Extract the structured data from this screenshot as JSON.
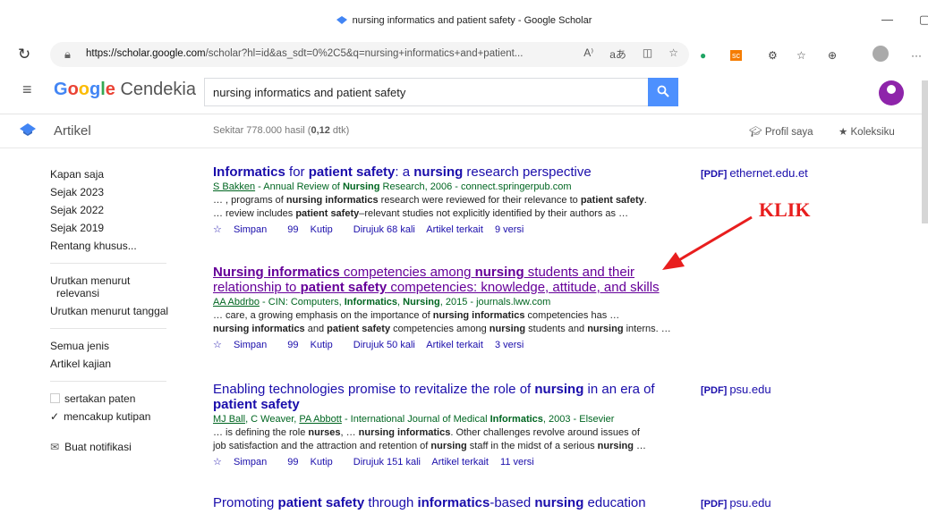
{
  "browser": {
    "tab_title": "nursing informatics and patient safety - Google Scholar",
    "url_host": "https://scholar.google.com",
    "url_path": "/scholar?hl=id&as_sdt=0%2C5&q=nursing+informatics+and+patient...",
    "refresh_icon": "refresh-icon",
    "ext_sc": "sc"
  },
  "header": {
    "logo_google": "Google",
    "logo_rest": " Cendekia",
    "query": "nursing informatics and patient safety"
  },
  "subheader": {
    "section": "Artikel",
    "stats_prefix": "Sekitar 778.000 hasil (",
    "stats_time": "0,12",
    "stats_suffix": " dtk)",
    "profile": "Profil saya",
    "collection": "Koleksiku"
  },
  "sidebar": {
    "time_any": "Kapan saja",
    "time_items": [
      "Sejak 2023",
      "Sejak 2022",
      "Sejak 2019",
      "Rentang khusus..."
    ],
    "sort_rel_1": "Urutkan menurut",
    "sort_rel_2": "relevansi",
    "sort_date": "Urutkan menurut tanggal",
    "type_all": "Semua jenis",
    "type_review": "Artikel kajian",
    "incl_patents": "sertakan paten",
    "incl_citations": "mencakup kutipan",
    "alert": "Buat notifikasi"
  },
  "annotation": {
    "klik": "KLIK"
  },
  "results": [
    {
      "pdf_tag": "[PDF]",
      "pdf_host": "ethernet.edu.et",
      "cited": "Dirujuk 68 kali",
      "versions": "9 versi"
    },
    {
      "cited": "Dirujuk 50 kali",
      "versions": "3 versi"
    },
    {
      "pdf_tag": "[PDF]",
      "pdf_host": "psu.edu",
      "cited": "Dirujuk 151 kali",
      "versions": "11 versi"
    },
    {
      "pdf_tag": "[PDF]",
      "pdf_host": "psu.edu"
    }
  ],
  "actions": {
    "save": "Simpan",
    "cite": "Kutip",
    "related": "Artikel terkait"
  },
  "colors": {
    "link": "#1a0dab",
    "visited": "#660099",
    "green": "#006621",
    "accent": "#4d90fe",
    "annotation": "#e81e1e"
  }
}
